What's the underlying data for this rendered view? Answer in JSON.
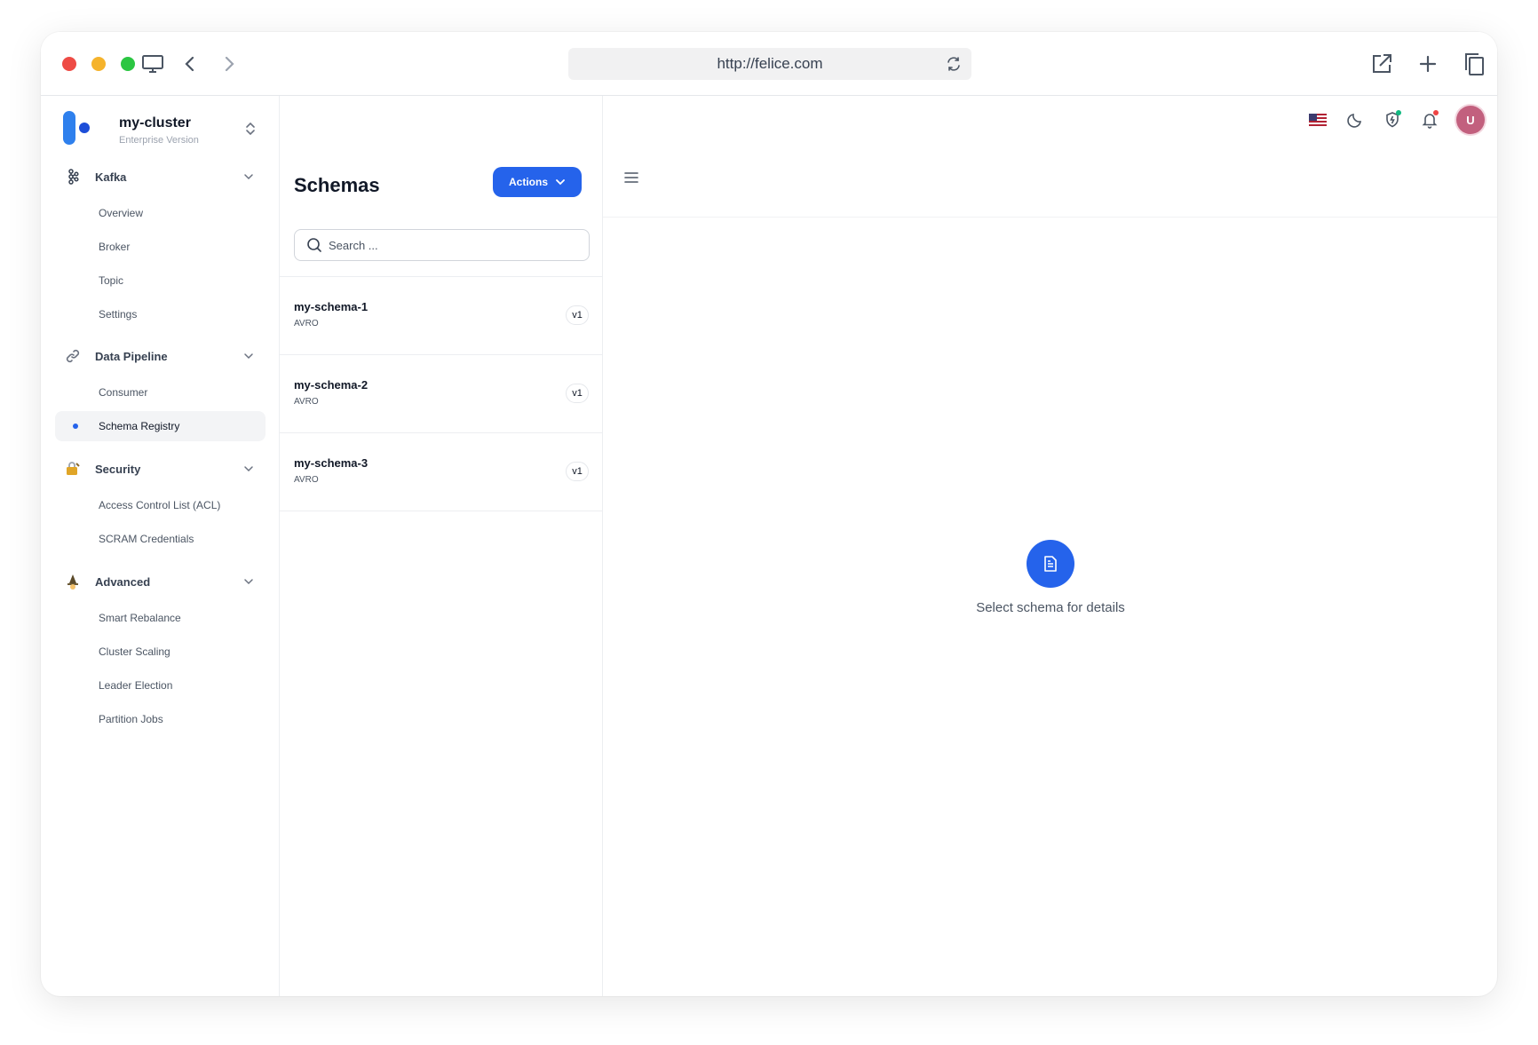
{
  "browser": {
    "url": "http://felice.com"
  },
  "cluster": {
    "name": "my-cluster",
    "edition": "Enterprise Version"
  },
  "sidebar": {
    "groups": [
      {
        "label": "Kafka",
        "icon": "kafka-icon",
        "items": [
          "Overview",
          "Broker",
          "Topic",
          "Settings"
        ]
      },
      {
        "label": "Data Pipeline",
        "icon": "link-icon",
        "items": [
          "Consumer",
          "Schema Registry"
        ]
      },
      {
        "label": "Security",
        "icon": "lock-icon",
        "items": [
          "Access Control List (ACL)",
          "SCRAM Credentials"
        ]
      },
      {
        "label": "Advanced",
        "icon": "wizard-icon",
        "items": [
          "Smart Rebalance",
          "Cluster Scaling",
          "Leader Election",
          "Partition Jobs"
        ]
      }
    ],
    "active_item": "Schema Registry"
  },
  "schemas": {
    "title": "Schemas",
    "actions_label": "Actions",
    "search_placeholder": "Search ...",
    "list": [
      {
        "name": "my-schema-1",
        "type": "AVRO",
        "version": "v1"
      },
      {
        "name": "my-schema-2",
        "type": "AVRO",
        "version": "v1"
      },
      {
        "name": "my-schema-3",
        "type": "AVRO",
        "version": "v1"
      }
    ]
  },
  "detail": {
    "empty_message": "Select schema for details"
  },
  "header": {
    "avatar_initial": "U",
    "language_flag": "us-flag-icon"
  },
  "colors": {
    "primary": "#2563eb",
    "avatar": "#c2607e",
    "notification_dot": "#ef4444",
    "shield_dot": "#10b981"
  }
}
